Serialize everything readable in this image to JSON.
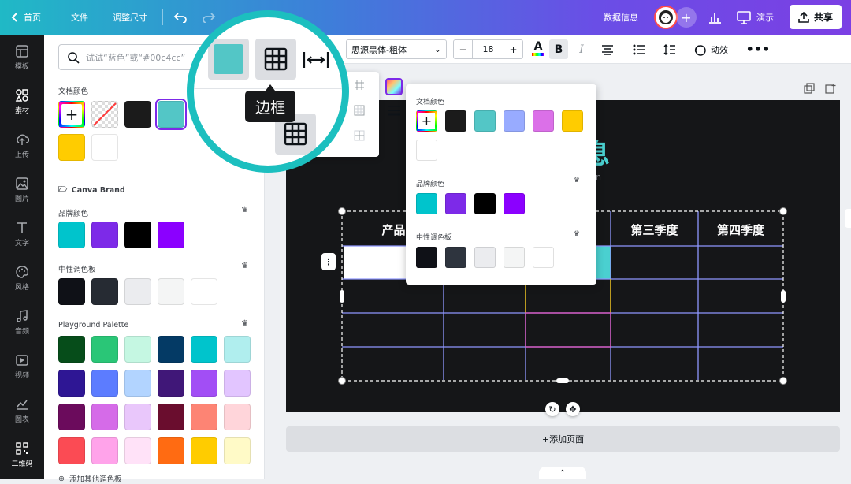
{
  "topbar": {
    "home": "首页",
    "file": "文件",
    "resize": "调整尺寸",
    "doc_title": "数据信息",
    "present": "演示",
    "share": "共享"
  },
  "toolbar": {
    "font": "思源黑体-粗体",
    "font_size": "18",
    "minus": "−",
    "plus": "+",
    "animate": "动效"
  },
  "rail": {
    "items": [
      "模板",
      "素材",
      "上传",
      "图片",
      "文字",
      "风格",
      "音频",
      "视频",
      "图表",
      "二维码"
    ],
    "active": "素材"
  },
  "panel": {
    "search_placeholder": "试试“蓝色”或“#00c4cc”",
    "doc_colors_label": "文档颜色",
    "brand_kit": "Canva Brand",
    "brand_colors_label": "品牌颜色",
    "neutral_label": "中性调色板",
    "playground_label": "Playground Palette",
    "add_palette": "添加其他调色板",
    "doc_colors": [
      "#1b1b1b",
      "#53c6c6",
      "#ffcc00",
      "#ffffff"
    ],
    "brand_colors": [
      "#00c4cc",
      "#7d2ae8",
      "#000000",
      "#8b00ff"
    ],
    "neutral_colors": [
      "#0f1117",
      "#262b33",
      "#ebecef",
      "#f4f5f5",
      "#ffffff"
    ],
    "playground_colors": [
      "#064d1a",
      "#2ac677",
      "#c5f7e2",
      "#043a65",
      "#00c4cc",
      "#b0eeee",
      "#2e1694",
      "#5c7cff",
      "#b2d4ff",
      "#401778",
      "#a24ef5",
      "#e2c5ff",
      "#6b0b5c",
      "#d56be8",
      "#e9c7fb",
      "#6a0d2e",
      "#fd8474",
      "#ffd5da",
      "#fb4b54",
      "#ffa3ea",
      "#ffe2f8",
      "#ff6b12",
      "#ffcc00",
      "#fffac7"
    ]
  },
  "popover": {
    "doc_colors_label": "文档颜色",
    "brand_colors_label": "品牌颜色",
    "neutral_label": "中性调色板",
    "doc_colors": [
      "#1b1b1b",
      "#53c6c6",
      "#98abff",
      "#db70e8",
      "#ffcc00",
      "#ffffff"
    ],
    "brand_colors": [
      "#00c4cc",
      "#7d2ae8",
      "#000000",
      "#8b00ff"
    ],
    "neutral_colors": [
      "#0f1117",
      "#2e343e",
      "#ebecef",
      "#f4f5f5",
      "#ffffff"
    ]
  },
  "canvas": {
    "title_fragment": "息",
    "subtitle_fragment": "n",
    "headers": [
      "产品",
      "",
      "",
      "第三季度",
      "第四季度"
    ],
    "add_page": "+添加页面"
  },
  "lens": {
    "tooltip": "边框"
  },
  "colors": {
    "accent": "#1cbfbf",
    "table_line": "#8f97ff",
    "highlight_line": "#e65cc9",
    "yellow_line": "#ffcc00"
  }
}
